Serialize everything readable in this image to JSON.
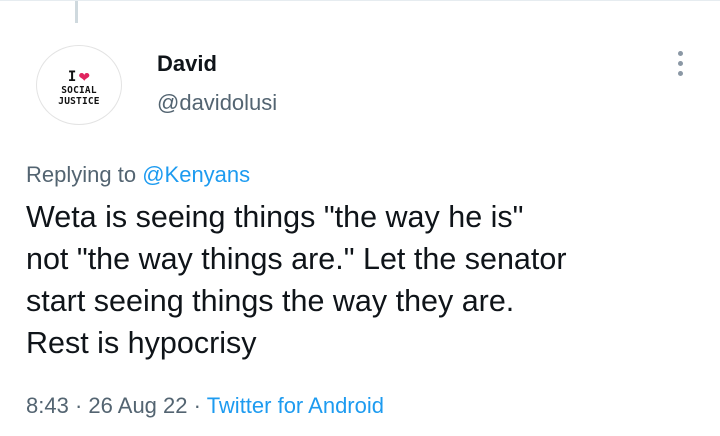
{
  "tweet": {
    "author": {
      "name": "David",
      "handle": "@davidolusi",
      "avatar": {
        "line1_letter": "I",
        "line1_icon": "heart-icon",
        "line2": "SOCIAL",
        "line3": "JUSTICE",
        "heart_color": "#e0245e"
      }
    },
    "more_icon": "more-vertical-icon",
    "replying_prefix": "Replying to",
    "replying_to": "@Kenyans",
    "text": "Weta is seeing things \"the way he is\"\nnot \"the way things are.\" Let the senator\nstart seeing things the way they are.\nRest is hypocrisy",
    "time": "8:43",
    "separator": "·",
    "date": "26 Aug 22",
    "source": "Twitter for Android"
  },
  "colors": {
    "link": "#1d9bf0",
    "muted": "#536471",
    "text": "#0f1419"
  }
}
